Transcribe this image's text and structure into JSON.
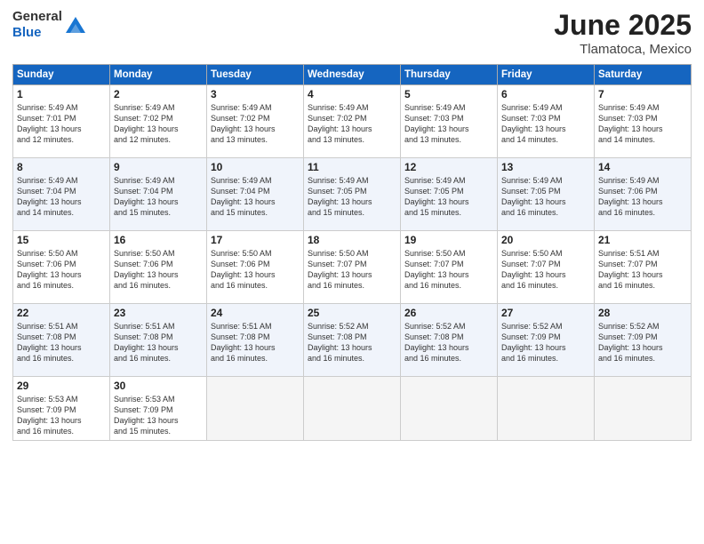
{
  "logo": {
    "line1": "General",
    "line2": "Blue"
  },
  "title": "June 2025",
  "location": "Tlamatoca, Mexico",
  "weekdays": [
    "Sunday",
    "Monday",
    "Tuesday",
    "Wednesday",
    "Thursday",
    "Friday",
    "Saturday"
  ],
  "weeks": [
    [
      {
        "day": "1",
        "info": "Sunrise: 5:49 AM\nSunset: 7:01 PM\nDaylight: 13 hours\nand 12 minutes."
      },
      {
        "day": "2",
        "info": "Sunrise: 5:49 AM\nSunset: 7:02 PM\nDaylight: 13 hours\nand 12 minutes."
      },
      {
        "day": "3",
        "info": "Sunrise: 5:49 AM\nSunset: 7:02 PM\nDaylight: 13 hours\nand 13 minutes."
      },
      {
        "day": "4",
        "info": "Sunrise: 5:49 AM\nSunset: 7:02 PM\nDaylight: 13 hours\nand 13 minutes."
      },
      {
        "day": "5",
        "info": "Sunrise: 5:49 AM\nSunset: 7:03 PM\nDaylight: 13 hours\nand 13 minutes."
      },
      {
        "day": "6",
        "info": "Sunrise: 5:49 AM\nSunset: 7:03 PM\nDaylight: 13 hours\nand 14 minutes."
      },
      {
        "day": "7",
        "info": "Sunrise: 5:49 AM\nSunset: 7:03 PM\nDaylight: 13 hours\nand 14 minutes."
      }
    ],
    [
      {
        "day": "8",
        "info": "Sunrise: 5:49 AM\nSunset: 7:04 PM\nDaylight: 13 hours\nand 14 minutes."
      },
      {
        "day": "9",
        "info": "Sunrise: 5:49 AM\nSunset: 7:04 PM\nDaylight: 13 hours\nand 15 minutes."
      },
      {
        "day": "10",
        "info": "Sunrise: 5:49 AM\nSunset: 7:04 PM\nDaylight: 13 hours\nand 15 minutes."
      },
      {
        "day": "11",
        "info": "Sunrise: 5:49 AM\nSunset: 7:05 PM\nDaylight: 13 hours\nand 15 minutes."
      },
      {
        "day": "12",
        "info": "Sunrise: 5:49 AM\nSunset: 7:05 PM\nDaylight: 13 hours\nand 15 minutes."
      },
      {
        "day": "13",
        "info": "Sunrise: 5:49 AM\nSunset: 7:05 PM\nDaylight: 13 hours\nand 16 minutes."
      },
      {
        "day": "14",
        "info": "Sunrise: 5:49 AM\nSunset: 7:06 PM\nDaylight: 13 hours\nand 16 minutes."
      }
    ],
    [
      {
        "day": "15",
        "info": "Sunrise: 5:50 AM\nSunset: 7:06 PM\nDaylight: 13 hours\nand 16 minutes."
      },
      {
        "day": "16",
        "info": "Sunrise: 5:50 AM\nSunset: 7:06 PM\nDaylight: 13 hours\nand 16 minutes."
      },
      {
        "day": "17",
        "info": "Sunrise: 5:50 AM\nSunset: 7:06 PM\nDaylight: 13 hours\nand 16 minutes."
      },
      {
        "day": "18",
        "info": "Sunrise: 5:50 AM\nSunset: 7:07 PM\nDaylight: 13 hours\nand 16 minutes."
      },
      {
        "day": "19",
        "info": "Sunrise: 5:50 AM\nSunset: 7:07 PM\nDaylight: 13 hours\nand 16 minutes."
      },
      {
        "day": "20",
        "info": "Sunrise: 5:50 AM\nSunset: 7:07 PM\nDaylight: 13 hours\nand 16 minutes."
      },
      {
        "day": "21",
        "info": "Sunrise: 5:51 AM\nSunset: 7:07 PM\nDaylight: 13 hours\nand 16 minutes."
      }
    ],
    [
      {
        "day": "22",
        "info": "Sunrise: 5:51 AM\nSunset: 7:08 PM\nDaylight: 13 hours\nand 16 minutes."
      },
      {
        "day": "23",
        "info": "Sunrise: 5:51 AM\nSunset: 7:08 PM\nDaylight: 13 hours\nand 16 minutes."
      },
      {
        "day": "24",
        "info": "Sunrise: 5:51 AM\nSunset: 7:08 PM\nDaylight: 13 hours\nand 16 minutes."
      },
      {
        "day": "25",
        "info": "Sunrise: 5:52 AM\nSunset: 7:08 PM\nDaylight: 13 hours\nand 16 minutes."
      },
      {
        "day": "26",
        "info": "Sunrise: 5:52 AM\nSunset: 7:08 PM\nDaylight: 13 hours\nand 16 minutes."
      },
      {
        "day": "27",
        "info": "Sunrise: 5:52 AM\nSunset: 7:09 PM\nDaylight: 13 hours\nand 16 minutes."
      },
      {
        "day": "28",
        "info": "Sunrise: 5:52 AM\nSunset: 7:09 PM\nDaylight: 13 hours\nand 16 minutes."
      }
    ],
    [
      {
        "day": "29",
        "info": "Sunrise: 5:53 AM\nSunset: 7:09 PM\nDaylight: 13 hours\nand 16 minutes."
      },
      {
        "day": "30",
        "info": "Sunrise: 5:53 AM\nSunset: 7:09 PM\nDaylight: 13 hours\nand 15 minutes."
      },
      {
        "day": "",
        "info": ""
      },
      {
        "day": "",
        "info": ""
      },
      {
        "day": "",
        "info": ""
      },
      {
        "day": "",
        "info": ""
      },
      {
        "day": "",
        "info": ""
      }
    ]
  ]
}
